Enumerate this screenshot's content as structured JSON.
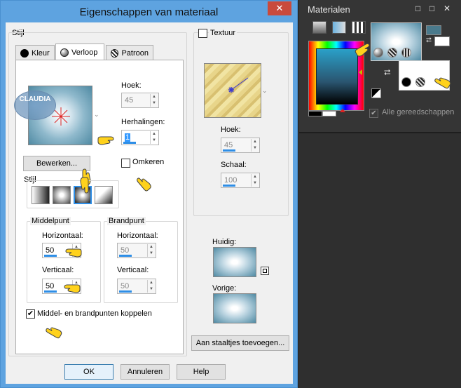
{
  "dialog": {
    "title": "Eigenschappen van materiaal",
    "close_label": "✕",
    "stijl_group": "Stijl",
    "tabs": [
      {
        "label": "Kleur"
      },
      {
        "label": "Verloop"
      },
      {
        "label": "Patroon"
      }
    ],
    "gradient": {
      "hoek_label": "Hoek:",
      "hoek_value": "45",
      "herhalingen_label": "Herhalingen:",
      "herhalingen_value": "1",
      "bewerken_label": "Bewerken...",
      "omkeren_label": "Omkeren",
      "stijl_label": "Stijl",
      "middelpunt_label": "Middelpunt",
      "brandpunt_label": "Brandpunt",
      "horizontaal_label": "Horizontaal:",
      "verticaal_label": "Verticaal:",
      "mid_h": "50",
      "mid_v": "50",
      "brand_h": "50",
      "brand_v": "50",
      "koppelen_label": "Middel- en brandpunten koppelen",
      "koppelen_checked": true
    },
    "texture": {
      "label": "Textuur",
      "checked": false,
      "hoek_label": "Hoek:",
      "hoek_value": "45",
      "schaal_label": "Schaal:",
      "schaal_value": "100"
    },
    "huidig_label": "Huidig:",
    "vorige_label": "Vorige:",
    "aan_staaltjes_label": "Aan staaltjes toevoegen...",
    "ok_label": "OK",
    "annuleren_label": "Annuleren",
    "help_label": "Help",
    "watermark_text": "CLAUDIA"
  },
  "palette": {
    "title": "Materialen",
    "controls": [
      "□",
      "□",
      "✕"
    ],
    "all_tools_label": "Alle gereedschappen"
  },
  "colors": {
    "gradient_center": "#ffffff",
    "gradient_mid": "#b9d3e0",
    "gradient_edge": "#4f8aa3",
    "accent": "#5ea3e0",
    "stroke_swatch": "#4a7a8c"
  }
}
